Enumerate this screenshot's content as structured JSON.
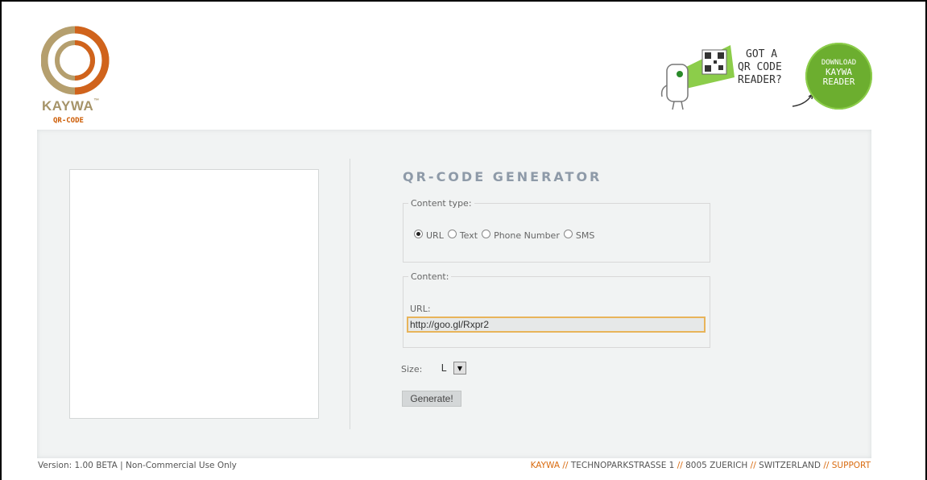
{
  "logo": {
    "brand": "KAYWA",
    "sub": "QR-CODE",
    "brand_color": "#9c8b67",
    "accent": "#cc5a00"
  },
  "promo": {
    "line1": "GOT A",
    "line2": "QR CODE",
    "line3": "READER?",
    "badge_line1": "DOWNLOAD",
    "badge_line2": "KAYWA",
    "badge_line3": "READER",
    "badge_color": "#6cae2f"
  },
  "generator": {
    "title": "QR-CODE GENERATOR",
    "content_type_legend": "Content type:",
    "options": [
      {
        "label": "URL",
        "selected": true
      },
      {
        "label": "Text",
        "selected": false
      },
      {
        "label": "Phone Number",
        "selected": false
      },
      {
        "label": "SMS",
        "selected": false
      }
    ],
    "content_legend": "Content:",
    "url_label": "URL:",
    "url_value": "http://goo.gl/Rxpr2",
    "size_label": "Size:",
    "size_value": "L",
    "generate_label": "Generate!"
  },
  "footer": {
    "version": "Version: 1.00 BETA | Non-Commercial Use Only",
    "company": "KAYWA",
    "address": "TECHNOPARKSTRASSE 1",
    "city": "8005 ZUERICH",
    "country": "SWITZERLAND",
    "support": "SUPPORT",
    "separator": "//"
  }
}
